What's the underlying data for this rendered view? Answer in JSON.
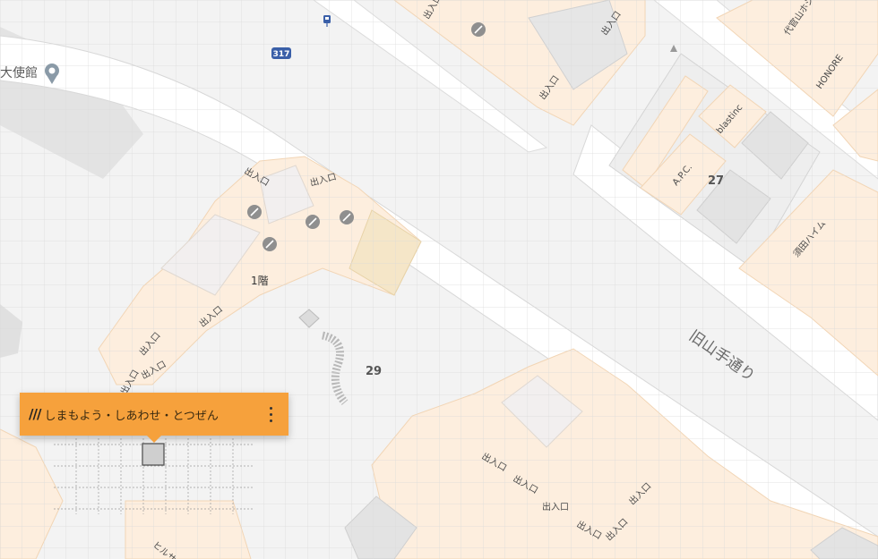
{
  "popup": {
    "prefix": "///",
    "words": "しまもよう・しあわせ・とつぜん",
    "menu_icon": "more-vertical-icon"
  },
  "map": {
    "embassy_label": "大使館",
    "route_number": "317",
    "street_name": "旧山手通り",
    "floor_label": "1階",
    "block_27": "27",
    "block_29": "29",
    "entrance_label": "出入口",
    "store_apc": "A.P.C.",
    "store_blastinc": "blastinc",
    "store_honore": "HONORE",
    "building_daikanyama": "代官山ホシノビル",
    "building_suda": "須田ハイム",
    "building_hiru": "ヒルサ",
    "colors": {
      "accent": "#f6a13c",
      "road": "#ffffff",
      "building": "#fdeede",
      "grid": "#d6d6d6"
    }
  }
}
